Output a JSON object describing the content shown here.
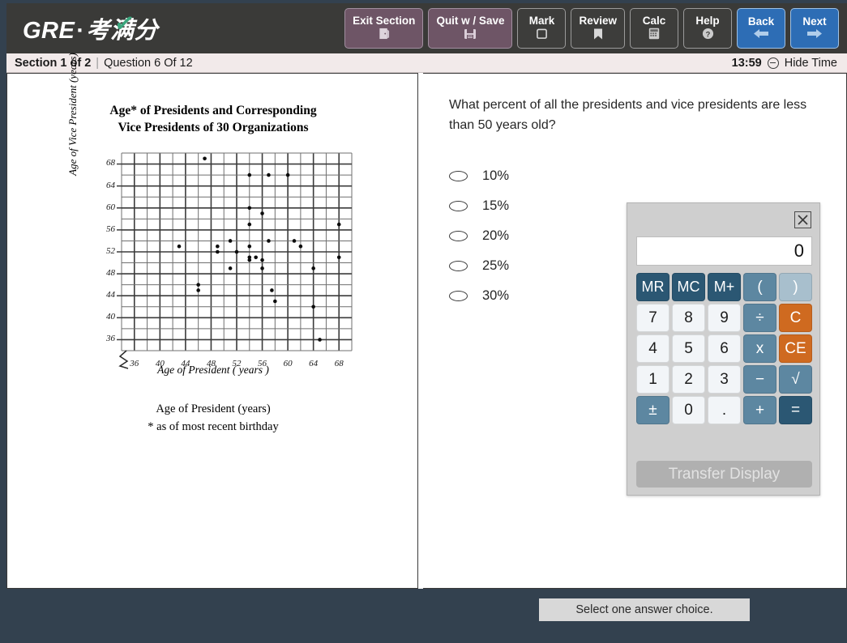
{
  "header": {
    "logo_main": "GRE",
    "logo_dot": "·",
    "logo_cn": "考满分",
    "buttons": [
      {
        "label": "Exit Section",
        "icon": "door-icon",
        "style": "plum"
      },
      {
        "label": "Quit w / Save",
        "icon": "save-icon",
        "style": "plum"
      },
      {
        "label": "Mark",
        "icon": "square-icon",
        "style": "dark"
      },
      {
        "label": "Review",
        "icon": "bookmark-icon",
        "style": "dark"
      },
      {
        "label": "Calc",
        "icon": "calculator-icon",
        "style": "dark"
      },
      {
        "label": "Help",
        "icon": "question-circle-icon",
        "style": "dark"
      },
      {
        "label": "Back",
        "icon": "arrow-left-icon",
        "style": "blue"
      },
      {
        "label": "Next",
        "icon": "arrow-right-icon",
        "style": "blue"
      }
    ]
  },
  "status": {
    "section": "Section 1 of 2",
    "separator": "|",
    "question": "Question 6 Of 12",
    "time": "13:59",
    "hide_time": "Hide Time"
  },
  "chart_data": {
    "type": "scatter",
    "title": "Age* of Presidents and Corresponding Vice Presidents of 30 Organizations",
    "title_line1": "Age* of Presidents and Corresponding",
    "title_line2": "Vice Presidents of 30 Organizations",
    "xlabel": "Age of President ( years )",
    "ylabel": "Age of Vice President (years)",
    "caption_line1": "Age of President (years)",
    "caption_line2": "* as of most recent birthday",
    "xlim": [
      34,
      70
    ],
    "ylim": [
      34,
      70
    ],
    "xticks": [
      36,
      40,
      44,
      48,
      52,
      56,
      60,
      64,
      68
    ],
    "yticks": [
      36,
      40,
      44,
      48,
      52,
      56,
      60,
      64,
      68
    ],
    "grid": true,
    "minor_step": 2,
    "axis_break": true,
    "legend": "none",
    "points": [
      [
        43,
        53
      ],
      [
        46,
        46
      ],
      [
        46,
        45
      ],
      [
        47,
        69
      ],
      [
        49,
        53
      ],
      [
        49,
        52
      ],
      [
        51,
        54
      ],
      [
        51,
        49
      ],
      [
        52,
        52
      ],
      [
        54,
        60
      ],
      [
        54,
        57
      ],
      [
        54,
        53
      ],
      [
        54,
        51
      ],
      [
        54,
        66
      ],
      [
        54,
        50.5
      ],
      [
        55,
        51
      ],
      [
        56,
        59
      ],
      [
        56,
        49
      ],
      [
        56,
        50.5
      ],
      [
        57,
        54
      ],
      [
        57,
        66
      ],
      [
        57.5,
        45
      ],
      [
        58,
        43
      ],
      [
        60,
        66
      ],
      [
        61,
        54
      ],
      [
        62,
        53
      ],
      [
        64,
        49
      ],
      [
        64,
        42
      ],
      [
        65,
        36
      ],
      [
        68,
        57
      ],
      [
        68,
        51
      ]
    ]
  },
  "question": {
    "text": "What percent of all the presidents and vice presidents are less than 50 years old?",
    "choices": [
      {
        "label": "10%",
        "selected": false
      },
      {
        "label": "15%",
        "selected": false
      },
      {
        "label": "20%",
        "selected": false
      },
      {
        "label": "25%",
        "selected": false
      },
      {
        "label": "30%",
        "selected": false
      }
    ]
  },
  "calculator": {
    "display": "0",
    "close_label": "close",
    "transfer_label": "Transfer Display",
    "keys": [
      {
        "label": "MR",
        "type": "mem"
      },
      {
        "label": "MC",
        "type": "mem"
      },
      {
        "label": "M+",
        "type": "mem"
      },
      {
        "label": "(",
        "type": "op"
      },
      {
        "label": ")",
        "type": "oplt"
      },
      {
        "label": "7",
        "type": "num"
      },
      {
        "label": "8",
        "type": "num"
      },
      {
        "label": "9",
        "type": "num"
      },
      {
        "label": "÷",
        "type": "op"
      },
      {
        "label": "C",
        "type": "warn"
      },
      {
        "label": "4",
        "type": "num"
      },
      {
        "label": "5",
        "type": "num"
      },
      {
        "label": "6",
        "type": "num"
      },
      {
        "label": "x",
        "type": "op"
      },
      {
        "label": "CE",
        "type": "warn"
      },
      {
        "label": "1",
        "type": "num"
      },
      {
        "label": "2",
        "type": "num"
      },
      {
        "label": "3",
        "type": "num"
      },
      {
        "label": "−",
        "type": "op"
      },
      {
        "label": "√",
        "type": "op"
      },
      {
        "label": "±",
        "type": "op"
      },
      {
        "label": "0",
        "type": "num"
      },
      {
        "label": ".",
        "type": "num"
      },
      {
        "label": "+",
        "type": "op"
      },
      {
        "label": "=",
        "type": "eq"
      }
    ]
  },
  "footer": {
    "hint": "Select one answer choice."
  },
  "colors": {
    "toolbar_bg": "#3a3a38",
    "statusbar_bg": "#f2eaea",
    "app_bg": "#33414f",
    "plum_button": "#6e5566",
    "blue_button": "#2d6db5",
    "calc_mem": "#2b5773",
    "calc_op": "#5d87a1",
    "calc_warn": "#cf6a20"
  }
}
